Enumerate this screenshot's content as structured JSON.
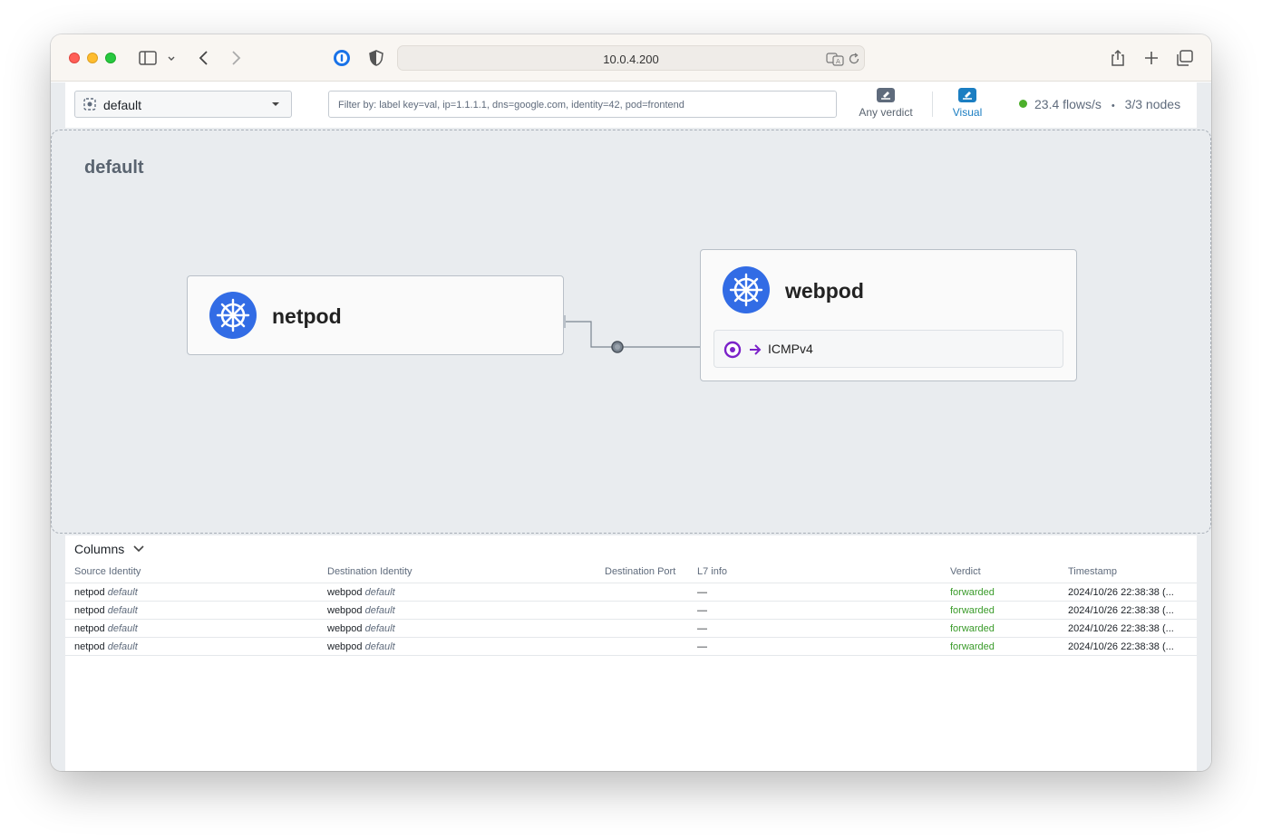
{
  "browser": {
    "url": "10.0.4.200"
  },
  "toolbar": {
    "namespace": "default",
    "filter_placeholder": "Filter by: label key=val, ip=1.1.1.1, dns=google.com, identity=42, pod=frontend",
    "verdict_label": "Any verdict",
    "visual_label": "Visual",
    "flows_rate": "23.4 flows/s",
    "separator": "•",
    "nodes": "3/3 nodes"
  },
  "map": {
    "namespace_label": "default",
    "source_card": {
      "title": "netpod"
    },
    "dest_card": {
      "title": "webpod",
      "protocol": "ICMPv4"
    }
  },
  "flows": {
    "columns_button": "Columns",
    "headers": {
      "source": "Source Identity",
      "destination": "Destination Identity",
      "dest_port": "Destination Port",
      "l7": "L7 info",
      "verdict": "Verdict",
      "timestamp": "Timestamp"
    },
    "rows": [
      {
        "source_name": "netpod",
        "source_ns": "default",
        "dest_name": "webpod",
        "dest_ns": "default",
        "l7": "—",
        "verdict": "forwarded",
        "timestamp": "2024/10/26 22:38:38 (..."
      },
      {
        "source_name": "netpod",
        "source_ns": "default",
        "dest_name": "webpod",
        "dest_ns": "default",
        "l7": "—",
        "verdict": "forwarded",
        "timestamp": "2024/10/26 22:38:38 (..."
      },
      {
        "source_name": "netpod",
        "source_ns": "default",
        "dest_name": "webpod",
        "dest_ns": "default",
        "l7": "—",
        "verdict": "forwarded",
        "timestamp": "2024/10/26 22:38:38 (..."
      },
      {
        "source_name": "netpod",
        "source_ns": "default",
        "dest_name": "webpod",
        "dest_ns": "default",
        "l7": "—",
        "verdict": "forwarded",
        "timestamp": "2024/10/26 22:38:38 (..."
      }
    ]
  },
  "colors": {
    "accent": "#1b7ec2",
    "k8s_blue": "#326ce5",
    "forwarded": "#3a9b2a",
    "protocol_purple": "#7b22c9"
  }
}
